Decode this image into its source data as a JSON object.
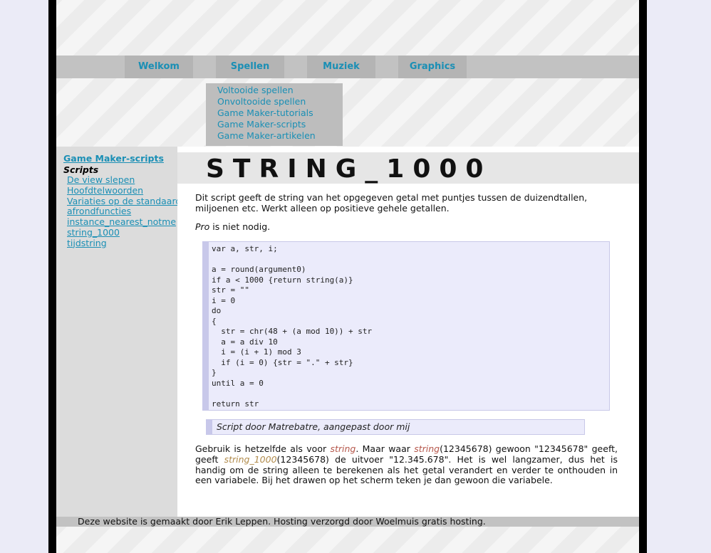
{
  "nav": {
    "items": [
      {
        "label": "Welkom"
      },
      {
        "label": "Spellen"
      },
      {
        "label": "Muziek"
      },
      {
        "label": "Graphics"
      }
    ]
  },
  "dropdown": {
    "items": [
      {
        "label": "Voltooide spellen"
      },
      {
        "label": "Onvoltooide spellen"
      },
      {
        "label": "Game Maker-tutorials"
      },
      {
        "label": "Game Maker-scripts"
      },
      {
        "label": "Game Maker-artikelen"
      }
    ]
  },
  "sidebar": {
    "section_title": "Game Maker-scripts",
    "sub_title": "Scripts",
    "links": [
      {
        "label": "De view slepen"
      },
      {
        "label": "Hoofdtelwoorden"
      },
      {
        "label": "Variaties op de standaard"
      },
      {
        "label": "afrondfuncties"
      },
      {
        "label": "instance_nearest_notme"
      },
      {
        "label": "string_1000"
      },
      {
        "label": "tijdstring"
      }
    ]
  },
  "content": {
    "title": "STRING_1000",
    "intro": "Dit script geeft de string van het opgegeven getal met puntjes tussen de duizendtallen, miljoenen etc. Werkt alleen op positieve gehele getallen.",
    "pro_word": "Pro",
    "pro_rest": " is niet nodig.",
    "code": "var a, str, i;\n\na = round(argument0)\nif a < 1000 {return string(a)}\nstr = \"\"\ni = 0\ndo\n{\n  str = chr(48 + (a mod 10)) + str\n  a = a div 10\n  i = (i + 1) mod 3\n  if (i = 0) {str = \".\" + str}\n}\nuntil a = 0\n\nreturn str",
    "credit": "Script door Matrebatre, aangepast door mij",
    "usage": {
      "p1": "Gebruik is hetzelfde als voor ",
      "kw1": "string",
      "p2": ". Maar waar ",
      "kw2": "string",
      "p3": "(12345678) gewoon \"12345678\" geeft, geeft ",
      "kw3": "string_1000",
      "p4": "(12345678) de uitvoer \"12.345.678\". Het is wel langzamer, dus het is handig om de string alleen te berekenen als het getal verandert en verder te onthouden in een variabele. Bij het drawen op het scherm teken je dan gewoon die variabele."
    }
  },
  "footer": {
    "text": "Deze website is gemaakt door Erik Leppen. Hosting verzorgd door Woelmuis gratis hosting."
  }
}
